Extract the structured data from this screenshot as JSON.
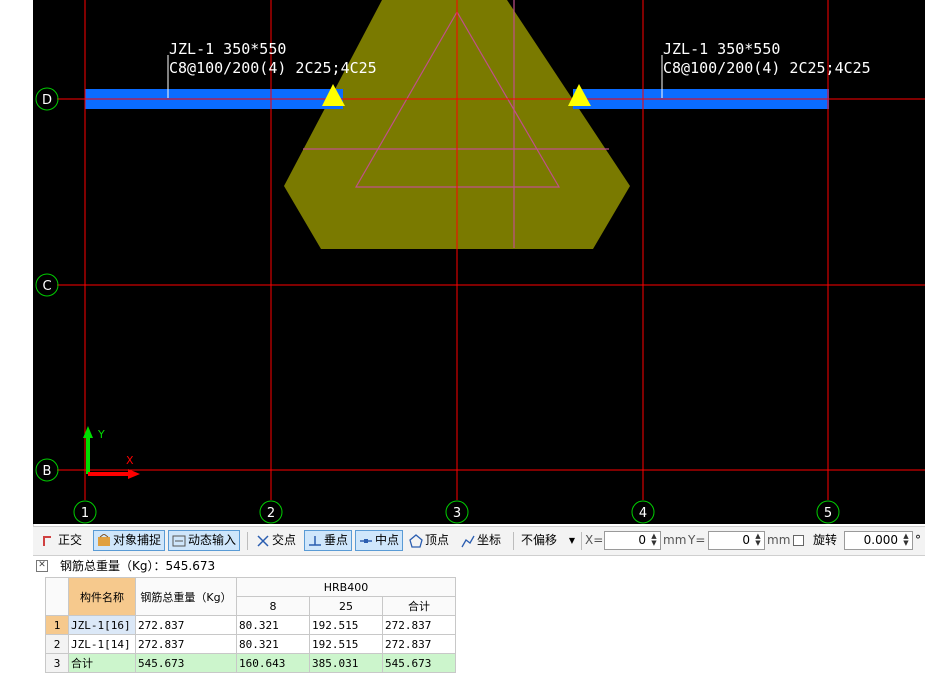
{
  "canvas": {
    "beams": [
      {
        "name": "JZL-1 350*550",
        "rebar": "C8@100/200(4) 2C25;4C25"
      },
      {
        "name": "JZL-1 350*550",
        "rebar": "C8@100/200(4) 2C25;4C25"
      }
    ],
    "row_axes": [
      "D",
      "C",
      "B"
    ],
    "col_axes": [
      "1",
      "2",
      "3",
      "4",
      "5"
    ],
    "ucs": {
      "x": "X",
      "y": "Y"
    },
    "colors": {
      "background": "#000000",
      "grid": "#ff0000",
      "beam": "#0a6cff",
      "cap": "#7a7a00",
      "support": "#ffff00"
    }
  },
  "toolbar": {
    "ortho": "正交",
    "osnap": "对象捕捉",
    "dynamic_input": "动态输入",
    "intersection": "交点",
    "perpendicular": "垂点",
    "midpoint": "中点",
    "vertex": "顶点",
    "coordinate": "坐标",
    "offset_mode": "不偏移",
    "x_label": "X=",
    "x_value": "0",
    "y_label": "Y=",
    "y_value": "0",
    "unit": "mm",
    "rotate_label": "旋转",
    "rotate_value": "0.000",
    "degree": "°"
  },
  "panel": {
    "title": "钢筋总重量（Kg）：545.673",
    "headers": {
      "name": "构件名称",
      "total_weight": "钢筋总重量（Kg）",
      "grade": "HRB400",
      "d8": "8",
      "d25": "25",
      "subtotal": "合计"
    },
    "rows": [
      {
        "no": "1",
        "name": "JZL-1[16]",
        "total": "272.837",
        "d8": "80.321",
        "d25": "192.515",
        "sum": "272.837"
      },
      {
        "no": "2",
        "name": "JZL-1[14]",
        "total": "272.837",
        "d8": "80.321",
        "d25": "192.515",
        "sum": "272.837"
      },
      {
        "no": "3",
        "name": "合计",
        "total": "545.673",
        "d8": "160.643",
        "d25": "385.031",
        "sum": "545.673"
      }
    ]
  }
}
